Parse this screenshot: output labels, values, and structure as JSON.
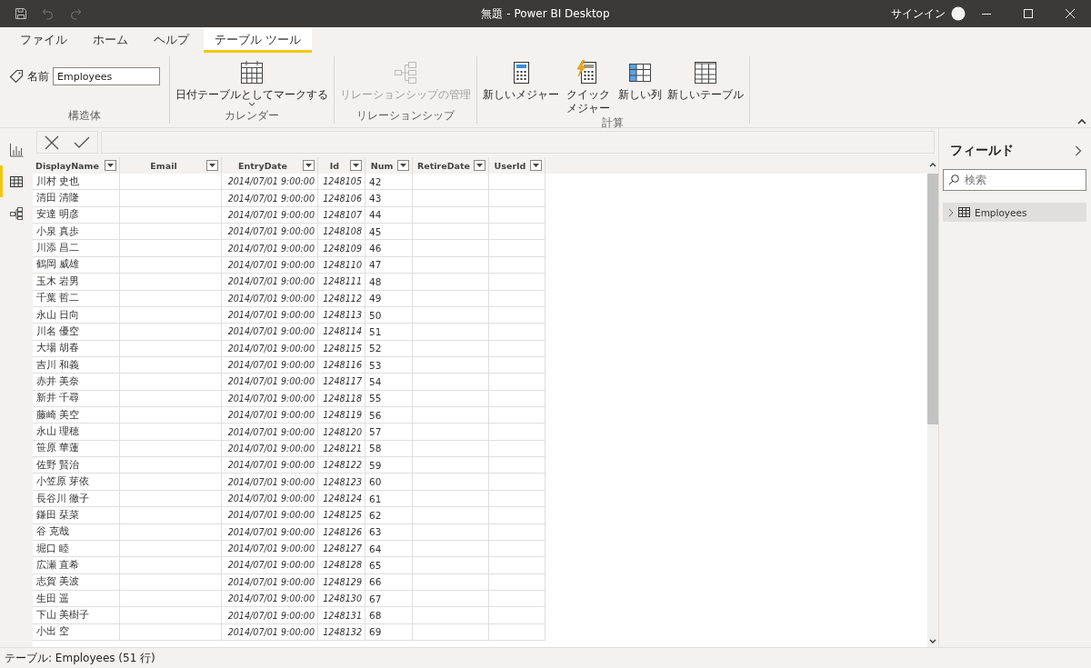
{
  "window": {
    "title": "無題 - Power BI Desktop",
    "signin": "サインイン"
  },
  "menu_tabs": [
    {
      "label": "ファイル",
      "selected": false
    },
    {
      "label": "ホーム",
      "selected": false
    },
    {
      "label": "ヘルプ",
      "selected": false
    },
    {
      "label": "テーブル ツール",
      "selected": true
    }
  ],
  "ribbon": {
    "groups": [
      {
        "label": "構造体",
        "items": [
          {
            "kind": "name-field",
            "label": "名前",
            "value": "Employees"
          }
        ]
      },
      {
        "label": "カレンダー",
        "items": [
          {
            "kind": "calendar",
            "label": "日付テーブルとしてマークする",
            "dropdown": true,
            "disabled": false
          }
        ]
      },
      {
        "label": "リレーションシップ",
        "items": [
          {
            "kind": "relationship",
            "label": "リレーションシップの管理",
            "dropdown": false,
            "disabled": true
          }
        ]
      },
      {
        "label": "計算",
        "items": [
          {
            "kind": "calculator",
            "label": "新しいメジャー",
            "dropdown": false,
            "disabled": false
          },
          {
            "kind": "quick-calc",
            "label": "クイックメジャー",
            "dropdown": false,
            "disabled": false
          },
          {
            "kind": "column",
            "label": "新しい列",
            "dropdown": false,
            "disabled": false
          },
          {
            "kind": "table",
            "label": "新しいテーブル",
            "dropdown": false,
            "disabled": false
          }
        ]
      }
    ]
  },
  "views": [
    {
      "kind": "report",
      "selected": false
    },
    {
      "kind": "data",
      "selected": true
    },
    {
      "kind": "model",
      "selected": false
    }
  ],
  "table": {
    "columns": [
      "DisplayName",
      "Email",
      "EntryDate",
      "Id",
      "Num",
      "RetireDate",
      "UserId"
    ],
    "rows": [
      {
        "cells": [
          "川村 史也",
          null,
          "2014/07/01 9:00:00",
          "1248105",
          "42",
          null,
          null
        ]
      },
      {
        "cells": [
          "清田 清隆",
          null,
          "2014/07/01 9:00:00",
          "1248106",
          "43",
          null,
          null
        ]
      },
      {
        "cells": [
          "安達 明彦",
          null,
          "2014/07/01 9:00:00",
          "1248107",
          "44",
          null,
          null
        ]
      },
      {
        "cells": [
          "小泉 真歩",
          null,
          "2014/07/01 9:00:00",
          "1248108",
          "45",
          null,
          null
        ]
      },
      {
        "cells": [
          "川添 昌二",
          null,
          "2014/07/01 9:00:00",
          "1248109",
          "46",
          null,
          null
        ]
      },
      {
        "cells": [
          "鶴岡 威雄",
          null,
          "2014/07/01 9:00:00",
          "1248110",
          "47",
          null,
          null
        ]
      },
      {
        "cells": [
          "玉木 岩男",
          null,
          "2014/07/01 9:00:00",
          "1248111",
          "48",
          null,
          null
        ]
      },
      {
        "cells": [
          "千葉 哲二",
          null,
          "2014/07/01 9:00:00",
          "1248112",
          "49",
          null,
          null
        ]
      },
      {
        "cells": [
          "永山 日向",
          null,
          "2014/07/01 9:00:00",
          "1248113",
          "50",
          null,
          null
        ]
      },
      {
        "cells": [
          "川名 優空",
          null,
          "2014/07/01 9:00:00",
          "1248114",
          "51",
          null,
          null
        ]
      },
      {
        "cells": [
          "大場 胡春",
          null,
          "2014/07/01 9:00:00",
          "1248115",
          "52",
          null,
          null
        ]
      },
      {
        "cells": [
          "吉川 和義",
          null,
          "2014/07/01 9:00:00",
          "1248116",
          "53",
          null,
          null
        ]
      },
      {
        "cells": [
          "赤井 美奈",
          null,
          "2014/07/01 9:00:00",
          "1248117",
          "54",
          null,
          null
        ]
      },
      {
        "cells": [
          "新井 千尋",
          null,
          "2014/07/01 9:00:00",
          "1248118",
          "55",
          null,
          null
        ]
      },
      {
        "cells": [
          "藤崎 美空",
          null,
          "2014/07/01 9:00:00",
          "1248119",
          "56",
          null,
          null
        ]
      },
      {
        "cells": [
          "永山 理穂",
          null,
          "2014/07/01 9:00:00",
          "1248120",
          "57",
          null,
          null
        ]
      },
      {
        "cells": [
          "笹原 華蓮",
          null,
          "2014/07/01 9:00:00",
          "1248121",
          "58",
          null,
          null
        ]
      },
      {
        "cells": [
          "佐野 賢治",
          null,
          "2014/07/01 9:00:00",
          "1248122",
          "59",
          null,
          null
        ]
      },
      {
        "cells": [
          "小笠原 芽依",
          null,
          "2014/07/01 9:00:00",
          "1248123",
          "60",
          null,
          null
        ]
      },
      {
        "cells": [
          "長谷川 徹子",
          null,
          "2014/07/01 9:00:00",
          "1248124",
          "61",
          null,
          null
        ]
      },
      {
        "cells": [
          "鎌田 栞菜",
          null,
          "2014/07/01 9:00:00",
          "1248125",
          "62",
          null,
          null
        ]
      },
      {
        "cells": [
          "谷 克哉",
          null,
          "2014/07/01 9:00:00",
          "1248126",
          "63",
          null,
          null
        ]
      },
      {
        "cells": [
          "堀口 睦",
          null,
          "2014/07/01 9:00:00",
          "1248127",
          "64",
          null,
          null
        ]
      },
      {
        "cells": [
          "広瀬 直希",
          null,
          "2014/07/01 9:00:00",
          "1248128",
          "65",
          null,
          null
        ]
      },
      {
        "cells": [
          "志賀 美波",
          null,
          "2014/07/01 9:00:00",
          "1248129",
          "66",
          null,
          null
        ]
      },
      {
        "cells": [
          "生田 遥",
          null,
          "2014/07/01 9:00:00",
          "1248130",
          "67",
          null,
          null
        ]
      },
      {
        "cells": [
          "下山 美樹子",
          null,
          "2014/07/01 9:00:00",
          "1248131",
          "68",
          null,
          null
        ]
      },
      {
        "cells": [
          "小出 空",
          null,
          "2014/07/01 9:00:00",
          "1248132",
          "69",
          null,
          null
        ]
      }
    ]
  },
  "fields": {
    "title": "フィールド",
    "search": {
      "placeholder": "検索"
    },
    "items": [
      {
        "label": "Employees",
        "expanded": false
      }
    ]
  },
  "status_bar": "テーブル: Employees (51 行)"
}
